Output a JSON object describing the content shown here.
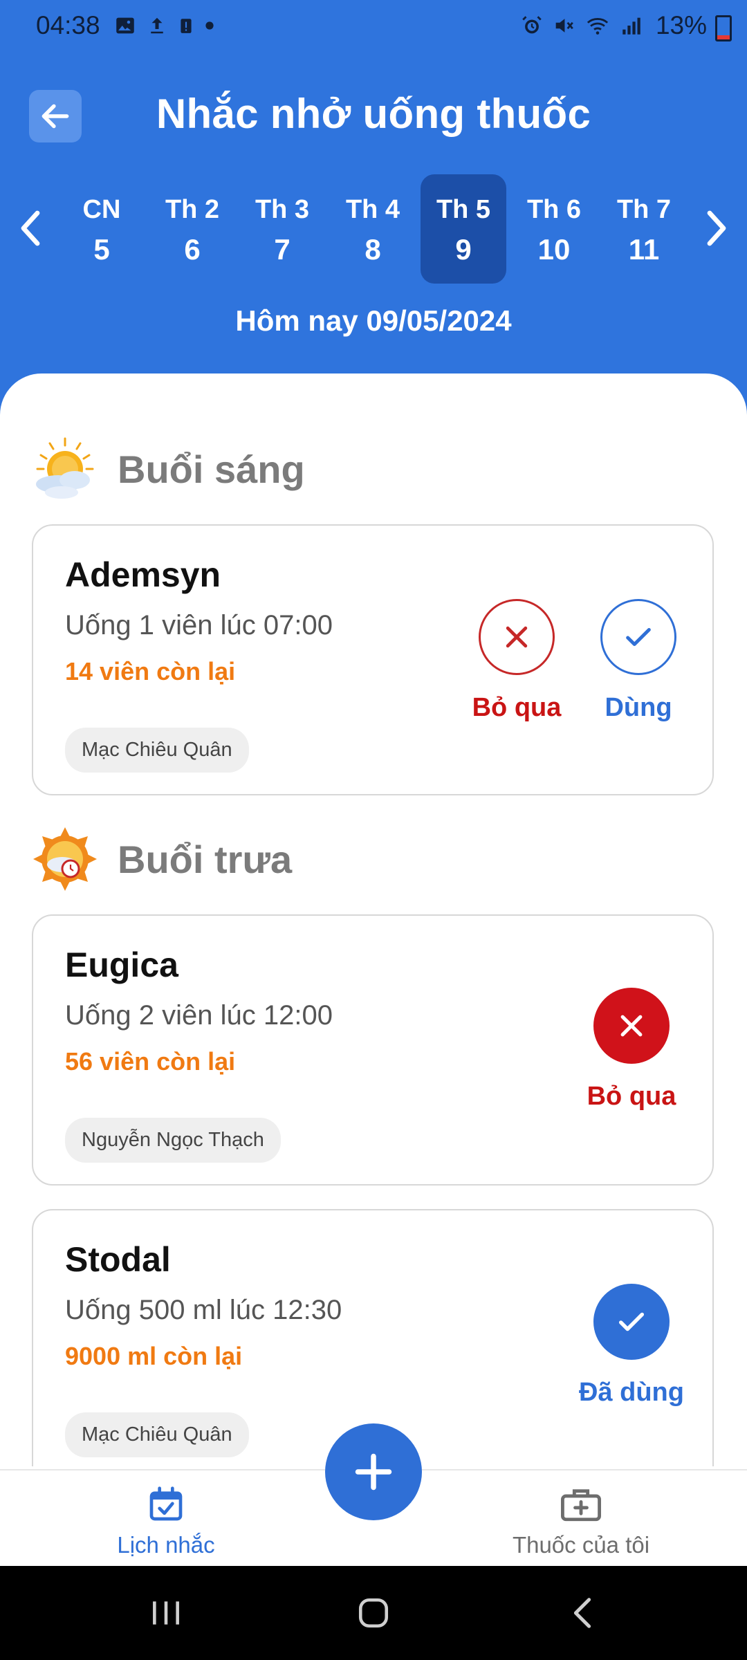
{
  "status_bar": {
    "time": "04:38",
    "battery": "13%"
  },
  "header": {
    "title": "Nhắc nhở uống thuốc"
  },
  "week": {
    "days": [
      {
        "name": "CN",
        "num": "5"
      },
      {
        "name": "Th 2",
        "num": "6"
      },
      {
        "name": "Th 3",
        "num": "7"
      },
      {
        "name": "Th 4",
        "num": "8"
      },
      {
        "name": "Th 5",
        "num": "9"
      },
      {
        "name": "Th 6",
        "num": "10"
      },
      {
        "name": "Th 7",
        "num": "11"
      }
    ],
    "selected_index": 4,
    "today_label": "Hôm nay 09/05/2024"
  },
  "sections": {
    "morning": {
      "title": "Buổi sáng",
      "icon": "sun-cloud-icon"
    },
    "noon": {
      "title": "Buổi trưa",
      "icon": "sun-clock-icon"
    }
  },
  "reminders": [
    {
      "name": "Ademsyn",
      "dose": "Uống 1 viên lúc 07:00",
      "remaining": "14 viên còn lại",
      "owner": "Mạc Chiêu Quân",
      "skip_label": "Bỏ qua",
      "take_label": "Dùng"
    },
    {
      "name": "Eugica",
      "dose": "Uống 2 viên lúc 12:00",
      "remaining": "56 viên còn lại",
      "owner": "Nguyễn Ngọc Thạch",
      "status_label": "Bỏ qua"
    },
    {
      "name": "Stodal",
      "dose": "Uống 500 ml lúc 12:30",
      "remaining": "9000 ml còn lại",
      "owner": "Mạc Chiêu Quân",
      "status_label": "Đã dùng"
    }
  ],
  "bottom_nav": {
    "schedule_label": "Lịch nhắc",
    "my_meds_label": "Thuốc của tôi"
  },
  "colors": {
    "primary": "#2f74dd",
    "skip_red": "#c91414",
    "remaining_orange": "#f07a12"
  }
}
